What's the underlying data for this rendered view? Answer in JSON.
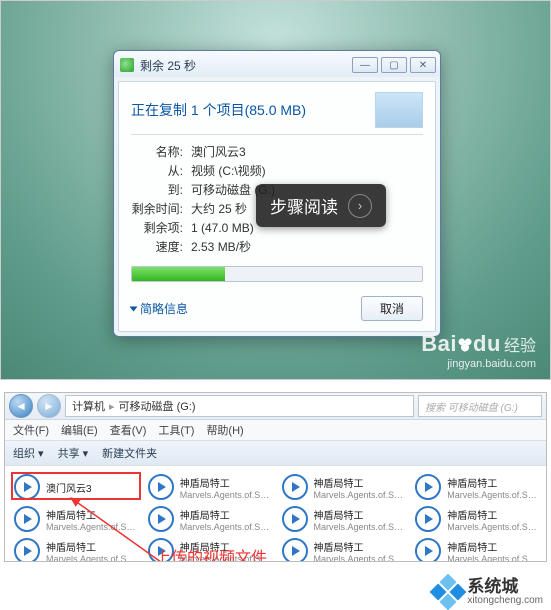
{
  "dialog": {
    "title": "剩余 25 秒",
    "heading": "正在复制 1 个项目(85.0 MB)",
    "rows": {
      "name_k": "名称:",
      "name_v": "澳门风云3",
      "from_k": "从:",
      "from_v": "视频 (C:\\视频)",
      "to_k": "到:",
      "to_v": "可移动磁盘 (G:)",
      "time_k": "剩余时间:",
      "time_v": "大约 25 秒",
      "items_k": "剩余项:",
      "items_v": "1 (47.0 MB)",
      "speed_k": "速度:",
      "speed_v": "2.53 MB/秒"
    },
    "more_info": "简略信息",
    "cancel": "取消"
  },
  "overlay": {
    "text": "步骤阅读"
  },
  "watermark1": {
    "brand": "Bai",
    "brand2": "du",
    "label": "经验",
    "url": "jingyan.baidu.com"
  },
  "explorer": {
    "breadcrumb": [
      "计算机",
      "可移动磁盘 (G:)"
    ],
    "search_placeholder": "搜索 可移动磁盘 (G:)",
    "menu": [
      "文件(F)",
      "编辑(E)",
      "查看(V)",
      "工具(T)",
      "帮助(H)"
    ],
    "tools": [
      "组织 ▾",
      "共享 ▾",
      "新建文件夹"
    ],
    "files": [
      {
        "l1": "澳门风云3",
        "l2": ""
      },
      {
        "l1": "神盾局特工",
        "l2": "Marvels.Agents.of.S.H.I.E.L.D.S..."
      },
      {
        "l1": "神盾局特工",
        "l2": "Marvels.Agents.of.S.H.I.E.L.D.S..."
      },
      {
        "l1": "神盾局特工",
        "l2": "Marvels.Agents.of.S.H.I.E.L.D.S..."
      },
      {
        "l1": "神盾局特工",
        "l2": "Marvels.Agents.of.S.H.I.E.L.D.S..."
      },
      {
        "l1": "神盾局特工",
        "l2": "Marvels.Agents.of.S.H.I.E.L.D.S..."
      },
      {
        "l1": "神盾局特工",
        "l2": "Marvels.Agents.of.S.H.I.E.L.D.S..."
      },
      {
        "l1": "神盾局特工",
        "l2": "Marvels.Agents.of.S.H.I.E.L.D.S..."
      },
      {
        "l1": "神盾局特工",
        "l2": "Marvels.Agents.of.S.H.I.E.L.D.S..."
      },
      {
        "l1": "神盾局特工",
        "l2": "Marvels.Agents.of.S.H.I.E.L.D.S..."
      },
      {
        "l1": "神盾局特工",
        "l2": "Marvels.Agents.of.S.H.I.E.L.D.S..."
      },
      {
        "l1": "神盾局特工",
        "l2": "Marvels.Agents.of.S.H.I.E.L.D.S..."
      }
    ],
    "caption": "上传的视频文件"
  },
  "watermark2": {
    "name": "系统城",
    "url": "xitongcheng.com"
  }
}
